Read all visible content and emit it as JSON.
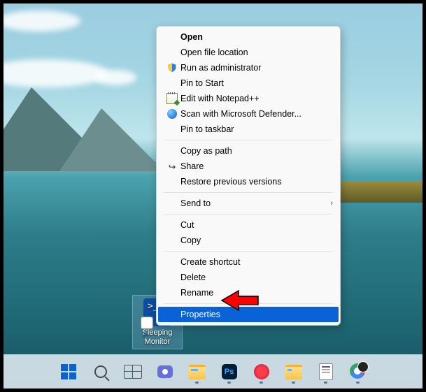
{
  "desktop": {
    "icon": {
      "label": "Sleeping Monitor"
    }
  },
  "context_menu": {
    "groups": [
      [
        {
          "label": "Open",
          "icon": null,
          "bold": true,
          "submenu": false
        },
        {
          "label": "Open file location",
          "icon": null,
          "bold": false,
          "submenu": false
        },
        {
          "label": "Run as administrator",
          "icon": "shield",
          "bold": false,
          "submenu": false
        },
        {
          "label": "Pin to Start",
          "icon": null,
          "bold": false,
          "submenu": false
        },
        {
          "label": "Edit with Notepad++",
          "icon": "notepad",
          "bold": false,
          "submenu": false
        },
        {
          "label": "Scan with Microsoft Defender...",
          "icon": "defender",
          "bold": false,
          "submenu": false
        },
        {
          "label": "Pin to taskbar",
          "icon": null,
          "bold": false,
          "submenu": false
        }
      ],
      [
        {
          "label": "Copy as path",
          "icon": null,
          "bold": false,
          "submenu": false
        },
        {
          "label": "Share",
          "icon": "share",
          "bold": false,
          "submenu": false
        },
        {
          "label": "Restore previous versions",
          "icon": null,
          "bold": false,
          "submenu": false
        }
      ],
      [
        {
          "label": "Send to",
          "icon": null,
          "bold": false,
          "submenu": true
        }
      ],
      [
        {
          "label": "Cut",
          "icon": null,
          "bold": false,
          "submenu": false
        },
        {
          "label": "Copy",
          "icon": null,
          "bold": false,
          "submenu": false
        }
      ],
      [
        {
          "label": "Create shortcut",
          "icon": null,
          "bold": false,
          "submenu": false
        },
        {
          "label": "Delete",
          "icon": null,
          "bold": false,
          "submenu": false
        },
        {
          "label": "Rename",
          "icon": null,
          "bold": false,
          "submenu": false
        }
      ],
      [
        {
          "label": "Properties",
          "icon": null,
          "bold": false,
          "submenu": false,
          "highlight": true
        }
      ]
    ]
  },
  "taskbar": {
    "items": [
      {
        "name": "start-button",
        "icon": "start",
        "running": false
      },
      {
        "name": "search-button",
        "icon": "search",
        "running": false
      },
      {
        "name": "task-view-button",
        "icon": "taskview",
        "running": false
      },
      {
        "name": "chat-button",
        "icon": "chat",
        "running": false
      },
      {
        "name": "file-explorer-button",
        "icon": "explorer",
        "running": true
      },
      {
        "name": "photoshop-button",
        "icon": "ps",
        "label": "Ps",
        "running": true
      },
      {
        "name": "opera-button",
        "icon": "opera",
        "running": true
      },
      {
        "name": "folder-pinned-button",
        "icon": "folder2",
        "running": true
      },
      {
        "name": "notepad-button",
        "icon": "notepad",
        "running": true
      },
      {
        "name": "chrome-button",
        "icon": "chrome-steam",
        "running": true
      }
    ]
  }
}
